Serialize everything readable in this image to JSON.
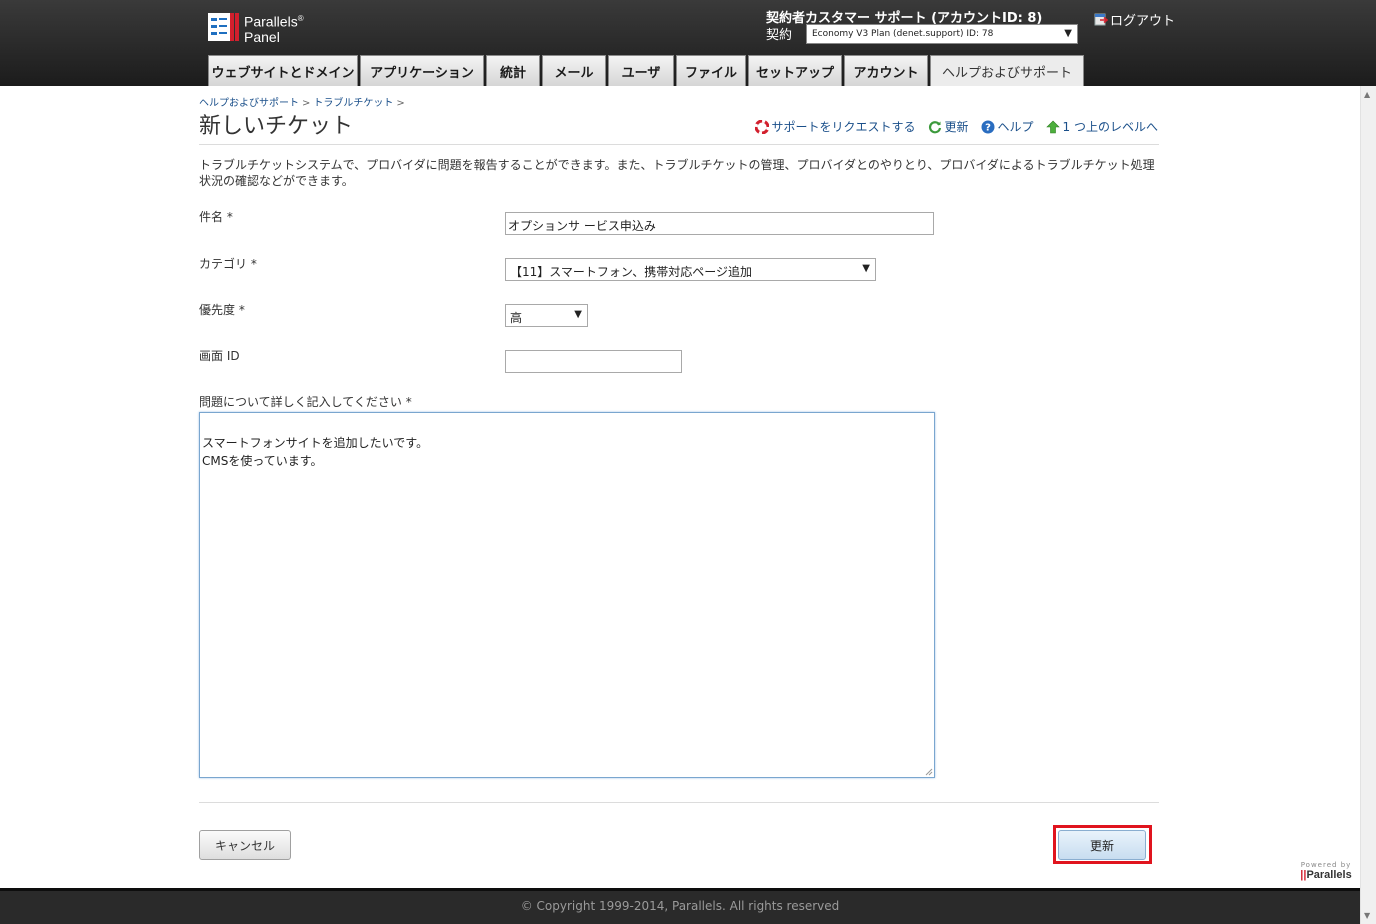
{
  "header": {
    "logo_line1": "Parallels",
    "logo_reg": "®",
    "logo_line2": "Panel",
    "owner_label": "契約者",
    "owner_name": "カスタマー サポート (アカウントID: 8)",
    "subscription_label": "契約",
    "subscription_value": "Economy V3 Plan (denet.support) ID: 78",
    "logout_label": "ログアウト"
  },
  "tabs": [
    {
      "label": "ウェブサイトとドメイン"
    },
    {
      "label": "アプリケーション"
    },
    {
      "label": "統計"
    },
    {
      "label": "メール"
    },
    {
      "label": "ユーザ"
    },
    {
      "label": "ファイル"
    },
    {
      "label": "セットアップ"
    },
    {
      "label": "アカウント"
    },
    {
      "label": "ヘルプおよびサポート"
    }
  ],
  "breadcrumb": [
    {
      "label": "ヘルプおよびサポート"
    },
    {
      "label": "トラブルチケット"
    }
  ],
  "breadcrumb_sep": ">",
  "page": {
    "title": "新しいチケット",
    "intro": "トラブルチケットシステムで、プロバイダに問題を報告することができます。また、トラブルチケットの管理、プロバイダとのやりとり、プロバイダによるトラブルチケット処理状況の確認などができます。"
  },
  "actions": [
    {
      "label": "サポートをリクエストする",
      "icon": "lifebuoy-icon"
    },
    {
      "label": "更新",
      "icon": "refresh-icon"
    },
    {
      "label": "ヘルプ",
      "icon": "help-icon"
    },
    {
      "label": "1 つ上のレベルへ",
      "icon": "up-level-icon"
    }
  ],
  "form": {
    "subject_label": "件名 *",
    "subject_value": "オプションサ ービス申込み",
    "category_label": "カテゴリ *",
    "category_value": "【11】スマートフォン、携帯対応ページ追加",
    "priority_label": "優先度 *",
    "priority_value": "高",
    "screen_id_label": "画面 ID",
    "screen_id_value": "",
    "details_label": "問題について詳しく記入してください *",
    "details_value": "スマートフォンサイトを追加したいです。\nCMSを使っています。"
  },
  "buttons": {
    "cancel": "キャンセル",
    "update": "更新"
  },
  "powered": {
    "line1": "Powered by",
    "bars": "||",
    "brand": "Parallels"
  },
  "footer": {
    "copyright": "© Copyright 1999-2014, Parallels. All rights reserved"
  },
  "colors": {
    "header_bg": "#1c1c1c",
    "link": "#1a4f8a",
    "highlight": "#e0141e",
    "footer_bg": "#2a2a2a"
  }
}
